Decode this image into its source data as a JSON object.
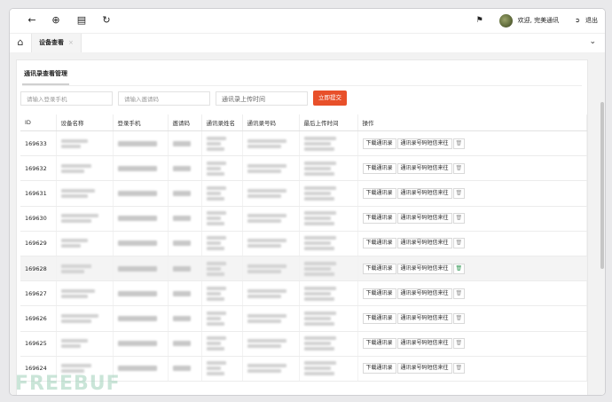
{
  "topbar": {
    "icons": [
      "arrow-left-icon",
      "crosshair-icon",
      "bank-icon",
      "refresh-icon"
    ],
    "tag_icon": "tag-icon",
    "welcome": "欢迎, 完美通讯",
    "logout": "退出"
  },
  "tabbar": {
    "home_icon": "home-icon",
    "tab_label": "设备查看",
    "tab_close": "×"
  },
  "panel": {
    "title": "通讯录查看管理",
    "search": {
      "phone_placeholder": "请输入登录手机",
      "code_placeholder": "请输入邀请码",
      "time_placeholder": "通讯录上传时间",
      "submit_label": "立即提交"
    },
    "columns": [
      "ID",
      "设备名称",
      "登录手机",
      "邀请码",
      "通讯录姓名",
      "通讯录号码",
      "最后上传时间",
      "操作"
    ],
    "actions": {
      "download": "下载通讯录",
      "phone_msg": "通讯录号码短信来往",
      "delete_icon": "trash-icon"
    },
    "rows": [
      {
        "id": "169633"
      },
      {
        "id": "169632"
      },
      {
        "id": "169631"
      },
      {
        "id": "169630"
      },
      {
        "id": "169629"
      },
      {
        "id": "169628",
        "highlighted": true
      },
      {
        "id": "169627"
      },
      {
        "id": "169626"
      },
      {
        "id": "169625"
      },
      {
        "id": "169624"
      }
    ]
  },
  "watermark": "FREEBUF"
}
